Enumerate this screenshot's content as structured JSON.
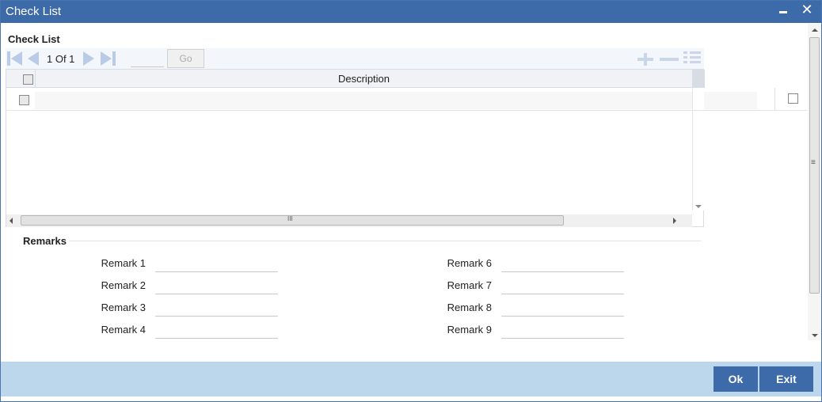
{
  "window": {
    "title": "Check List"
  },
  "checklist": {
    "section_title": "Check List",
    "pager": {
      "page_info": "1 Of 1",
      "go_label": "Go"
    },
    "columns": {
      "description": "Description"
    },
    "rows": [
      {
        "description": ""
      }
    ]
  },
  "remarks": {
    "title": "Remarks",
    "left": [
      {
        "label": "Remark 1",
        "value": ""
      },
      {
        "label": "Remark 2",
        "value": ""
      },
      {
        "label": "Remark 3",
        "value": ""
      },
      {
        "label": "Remark 4",
        "value": ""
      }
    ],
    "right": [
      {
        "label": "Remark 6",
        "value": ""
      },
      {
        "label": "Remark 7",
        "value": ""
      },
      {
        "label": "Remark 8",
        "value": ""
      },
      {
        "label": "Remark 9",
        "value": ""
      }
    ]
  },
  "footer": {
    "ok_label": "Ok",
    "exit_label": "Exit"
  },
  "colors": {
    "titlebar": "#3d6aa8",
    "footer": "#bcd6ec",
    "button": "#3d6aa8"
  }
}
